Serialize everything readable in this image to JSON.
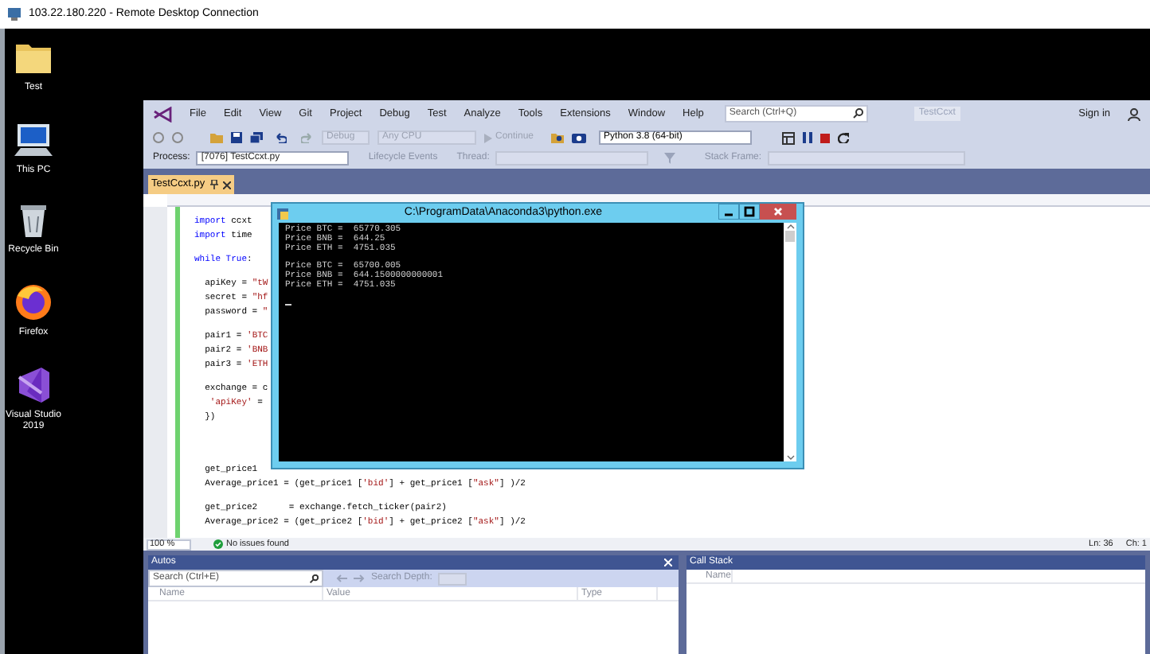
{
  "remote_window": {
    "title": "103.22.180.220 - Remote Desktop Connection"
  },
  "desktop_icons": [
    {
      "label": "Test",
      "kind": "folder"
    },
    {
      "label": "This PC",
      "kind": "computer"
    },
    {
      "label": "Recycle Bin",
      "kind": "bin"
    },
    {
      "label": "Firefox",
      "kind": "browser"
    },
    {
      "label": "Visual Studio 2019",
      "kind": "ide"
    }
  ],
  "ide": {
    "menu": [
      "File",
      "Edit",
      "View",
      "Git",
      "Project",
      "Debug",
      "Test",
      "Analyze",
      "Tools",
      "Extensions",
      "Window",
      "Help"
    ],
    "search": {
      "placeholder": "Search (Ctrl+Q)"
    },
    "solution_name": "TestCcxt",
    "sign_in": "Sign in",
    "toolbar": {
      "configuration": {
        "value": "Debug",
        "disabled": true
      },
      "platform": {
        "value": "Any CPU",
        "disabled": true
      },
      "continue": {
        "label": "Continue",
        "disabled": true
      },
      "environment": "Python 3.8 (64-bit)"
    },
    "debug_location": {
      "process_label": "Process:",
      "process": "[7076] TestCcxt.py",
      "lifecycle": {
        "label": "Lifecycle Events",
        "disabled": true
      },
      "thread_label": "Thread:",
      "stack_frame_label": "Stack Frame:"
    },
    "tabs": [
      {
        "label": "TestCcxt.py",
        "selected": true
      }
    ],
    "editor": {
      "sections": [
        [
          [
            [
              {
                "text": "import",
                "kind": "keyword"
              },
              {
                "text": " ccxt",
                "kind": "plain"
              }
            ],
            [
              {
                "text": "import",
                "kind": "keyword"
              },
              {
                "text": " time",
                "kind": "plain"
              }
            ]
          ],
          [
            [
              {
                "text": "while True",
                "kind": "keyword"
              },
              {
                "text": ":",
                "kind": "plain"
              }
            ]
          ],
          [
            [
              {
                "text": "  apiKey = ",
                "kind": "plain"
              },
              {
                "text": "\"tW",
                "kind": "string"
              }
            ],
            [
              {
                "text": "  secret = ",
                "kind": "plain"
              },
              {
                "text": "\"hf",
                "kind": "string"
              }
            ],
            [
              {
                "text": "  password = ",
                "kind": "plain"
              },
              {
                "text": "\"",
                "kind": "string"
              }
            ]
          ],
          [
            [
              {
                "text": "  pair1 = ",
                "kind": "plain"
              },
              {
                "text": "'BTC",
                "kind": "string"
              }
            ],
            [
              {
                "text": "  pair2 = ",
                "kind": "plain"
              },
              {
                "text": "'BNB",
                "kind": "string"
              }
            ],
            [
              {
                "text": "  pair3 = ",
                "kind": "plain"
              },
              {
                "text": "'ETH",
                "kind": "string"
              }
            ]
          ],
          [
            [
              {
                "text": "  exchange = c",
                "kind": "plain"
              }
            ],
            [
              {
                "text": "   'apiKey'",
                "kind": "string"
              },
              {
                "text": " =",
                "kind": "plain"
              }
            ],
            [
              {
                "text": "  })",
                "kind": "plain"
              }
            ]
          ]
        ],
        [
          [
            [
              {
                "text": "  get_price1",
                "kind": "plain"
              }
            ],
            [
              {
                "text": "  Average_price1 = (get_price1 [",
                "kind": "plain"
              },
              {
                "text": "'bid'",
                "kind": "string"
              },
              {
                "text": "] + get_price1 [",
                "kind": "plain"
              },
              {
                "text": "\"ask\"",
                "kind": "string"
              },
              {
                "text": "] )/2",
                "kind": "plain"
              }
            ]
          ],
          [
            [
              {
                "text": "  get_price2      = exchange.fetch_ticker(pair2)",
                "kind": "plain"
              }
            ],
            [
              {
                "text": "  Average_price2 = (get_price2 [",
                "kind": "plain"
              },
              {
                "text": "'bid'",
                "kind": "string"
              },
              {
                "text": "] + get_price2 [",
                "kind": "plain"
              },
              {
                "text": "\"ask\"",
                "kind": "string"
              },
              {
                "text": "] )/2",
                "kind": "plain"
              }
            ]
          ]
        ]
      ]
    },
    "status": {
      "zoom": "100 %",
      "issues": "No issues found",
      "line": "Ln: 36",
      "column": "Ch: 1"
    },
    "autos": {
      "title": "Autos",
      "search": {
        "placeholder": "Search (Ctrl+E)"
      },
      "search_depth": "Search Depth:",
      "columns": [
        "Name",
        "Value",
        "Type"
      ]
    },
    "call_stack": {
      "title": "Call Stack",
      "columns": [
        "Name"
      ]
    }
  },
  "console": {
    "title": "C:\\ProgramData\\Anaconda3\\python.exe",
    "blocks": [
      [
        "Price BTC =  65770.305",
        "Price BNB =  644.25",
        "Price ETH =  4751.035"
      ],
      [
        "Price BTC =  65700.005",
        "Price BNB =  644.1500000000001",
        "Price ETH =  4751.035"
      ]
    ]
  }
}
